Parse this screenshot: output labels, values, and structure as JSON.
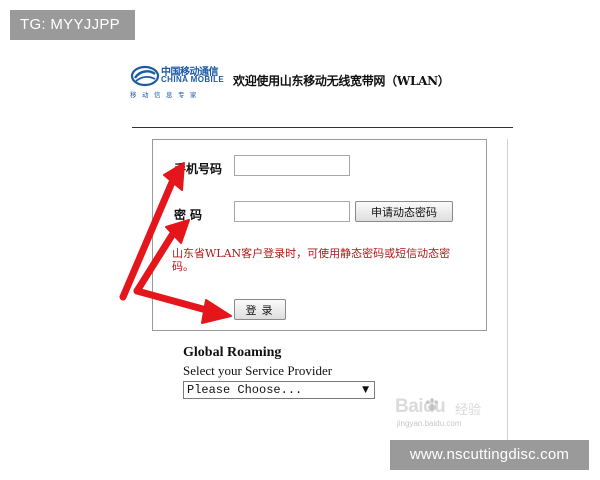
{
  "watermark_tag": "TG: MYYJJPP",
  "brand": {
    "logo_cn": "中国移动通信",
    "logo_en": "CHINA MOBILE",
    "logo_slogan": "移动信息专家",
    "color": "#1c5aa3"
  },
  "header": {
    "title": "欢迎使用山东移动无线宽带网（WLAN）"
  },
  "login": {
    "phone_label": "手机号码",
    "phone_value": "",
    "password_label": "密码",
    "password_value": "",
    "dynamic_password_button": "申请动态密码",
    "notice": "山东省WLAN客户登录时，可使用静态密码或短信动态密码。",
    "notice_color": "#b01919",
    "login_button": "登录"
  },
  "roaming": {
    "title": "Global Roaming",
    "subtitle": "Select your Service Provider",
    "selected_option": "Please Choose..."
  },
  "annotations": {
    "arrow_color": "#e5161b",
    "arrow_targets": [
      "phone-label",
      "password-label",
      "login-button"
    ]
  },
  "baidu_watermark": {
    "text": "Baidu",
    "cn": "经验",
    "url": "jingyan.baidu.com"
  },
  "site_tag": "www.nscuttingdisc.com",
  "icons": [
    "china-mobile-logo-icon",
    "dropdown-caret-icon",
    "red-arrow-icon",
    "baidu-paw-icon"
  ]
}
